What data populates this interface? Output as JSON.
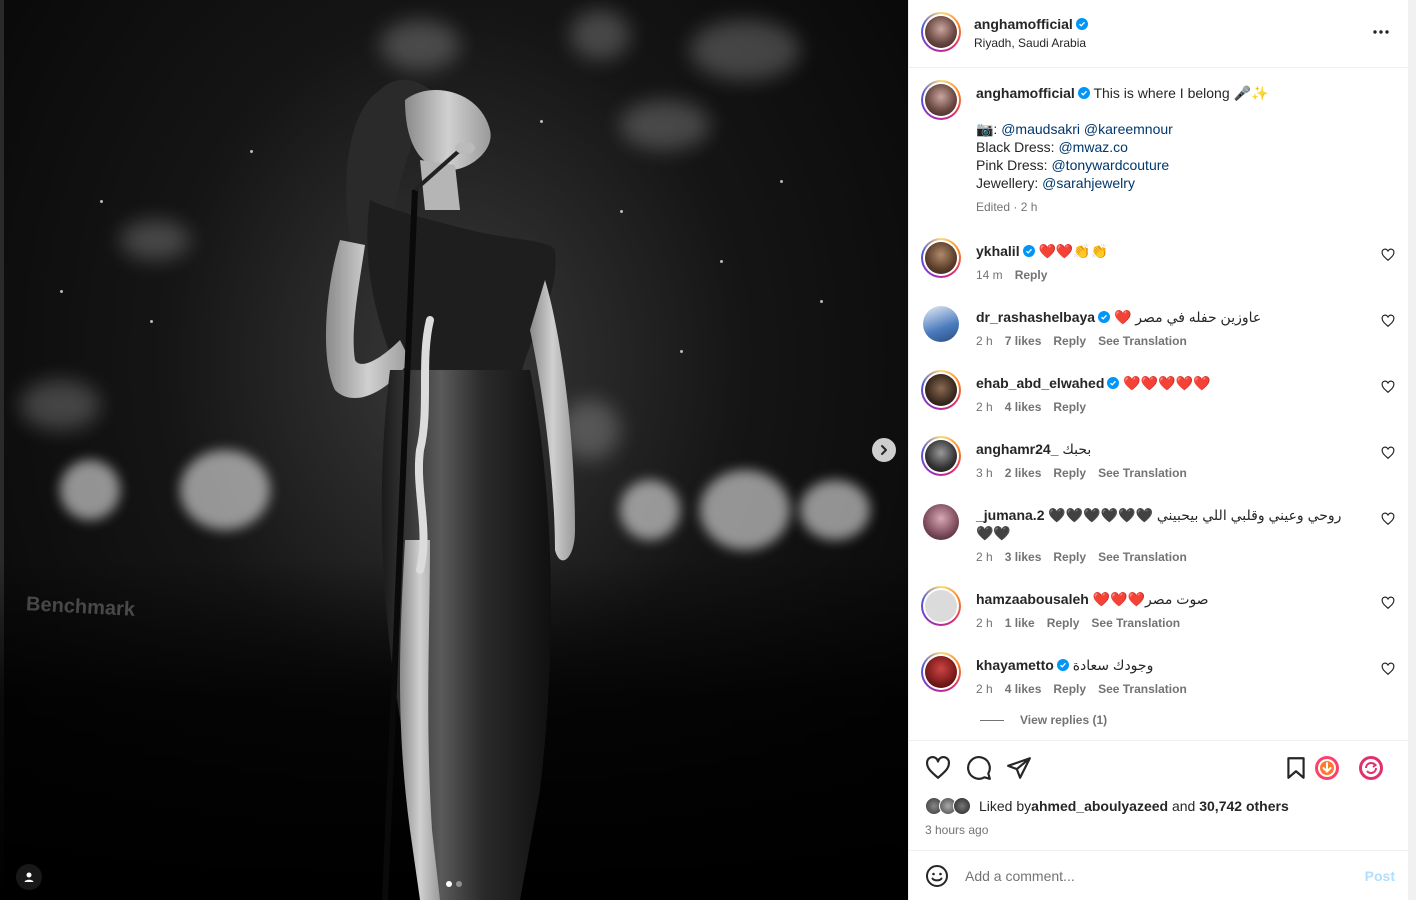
{
  "post": {
    "username": "anghamofficial",
    "location": "Riyadh, Saudi Arabia",
    "verified": true
  },
  "caption": {
    "username": "anghamofficial",
    "first_line": "This is where I belong 🎤✨",
    "credits_prefix": "📷: ",
    "credit_1": "@maudsakri",
    "credit_2": "@kareemnour",
    "black_dress_label": "Black Dress: ",
    "black_dress": "@mwaz.co",
    "pink_dress_label": "Pink Dress: ",
    "pink_dress": "@tonywardcouture",
    "jewellery_label": "Jewellery: ",
    "jewellery": "@sarahjewelry",
    "edited": "Edited",
    "edited_time": "2 h"
  },
  "comments": [
    {
      "username": "ykhalil",
      "verified": true,
      "text": "❤️❤️👏👏",
      "time": "14 m",
      "likes": "",
      "reply": "Reply",
      "translate": ""
    },
    {
      "username": "dr_rashashelbaya",
      "verified": true,
      "text": "عاوزين حفله في مصر ❤️",
      "time": "2 h",
      "likes": "7 likes",
      "reply": "Reply",
      "translate": "See Translation"
    },
    {
      "username": "ehab_abd_elwahed",
      "verified": true,
      "text": "❤️❤️❤️❤️❤️",
      "time": "2 h",
      "likes": "4 likes",
      "reply": "Reply",
      "translate": ""
    },
    {
      "username": "anghamr24_",
      "verified": false,
      "text": "بحبك",
      "time": "3 h",
      "likes": "2 likes",
      "reply": "Reply",
      "translate": "See Translation"
    },
    {
      "username": "_jumana.2",
      "verified": false,
      "text": "روحي وعيني وقلبي اللي بيحبيني 🖤🖤🖤🖤🖤🖤🖤🖤",
      "time": "2 h",
      "likes": "3 likes",
      "reply": "Reply",
      "translate": "See Translation"
    },
    {
      "username": "hamzaabousaleh",
      "verified": false,
      "text": "صوت مصر❤️❤️❤️",
      "time": "2 h",
      "likes": "1 like",
      "reply": "Reply",
      "translate": "See Translation"
    },
    {
      "username": "khayametto",
      "verified": true,
      "text": "وجودك سعادة",
      "time": "2 h",
      "likes": "4 likes",
      "reply": "Reply",
      "translate": "See Translation"
    }
  ],
  "view_replies": "View replies (1)",
  "likes": {
    "prefix": "Liked by ",
    "user": "ahmed_aboulyazeed",
    "middle": " and ",
    "others": "30,742 others"
  },
  "time_ago": "3 hours ago",
  "add_comment": {
    "placeholder": "Add a comment...",
    "post_label": "Post"
  },
  "photo": {
    "stage_brand": "Benchmark",
    "dots_total": 2,
    "dot_active": 1
  },
  "colors": {
    "verified": "#0095f6",
    "mention": "#00376b",
    "post_disabled": "#b2dffc",
    "heart_red": "#ed4956"
  },
  "icons": {
    "like": "heart-icon",
    "comment": "comment-bubble-icon",
    "share": "paper-plane-icon",
    "save": "bookmark-icon",
    "more": "more-horizontal-icon",
    "emoji": "emoji-smile-icon",
    "next": "chevron-right-icon",
    "tag": "user-tag-icon"
  }
}
